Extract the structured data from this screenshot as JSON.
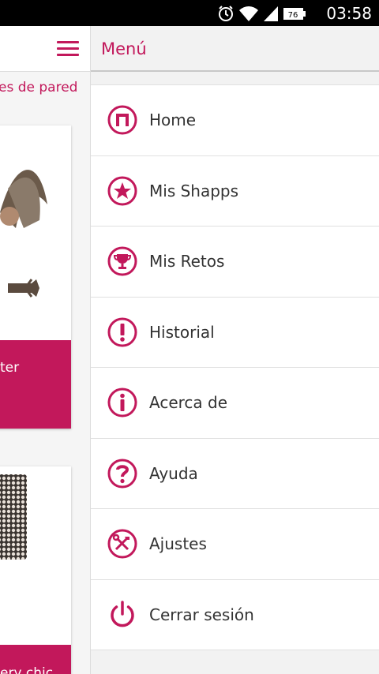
{
  "status_bar": {
    "time": "03:58",
    "battery": "76"
  },
  "background_page": {
    "subtitle": "es de pared",
    "cards": [
      {
        "label": "ter"
      },
      {
        "label": "ery chic"
      }
    ]
  },
  "drawer": {
    "title": "Menú",
    "items": [
      {
        "label": "Home",
        "icon": "home-icon"
      },
      {
        "label": "Mis Shapps",
        "icon": "star-icon"
      },
      {
        "label": "Mis Retos",
        "icon": "trophy-icon"
      },
      {
        "label": "Historial",
        "icon": "exclamation-icon"
      },
      {
        "label": "Acerca de",
        "icon": "info-icon"
      },
      {
        "label": "Ayuda",
        "icon": "question-icon"
      },
      {
        "label": "Ajustes",
        "icon": "tools-icon"
      },
      {
        "label": "Cerrar sesión",
        "icon": "power-icon"
      }
    ]
  },
  "colors": {
    "accent": "#c2185b",
    "status_bar": "#000000",
    "menu_text": "#333333"
  }
}
